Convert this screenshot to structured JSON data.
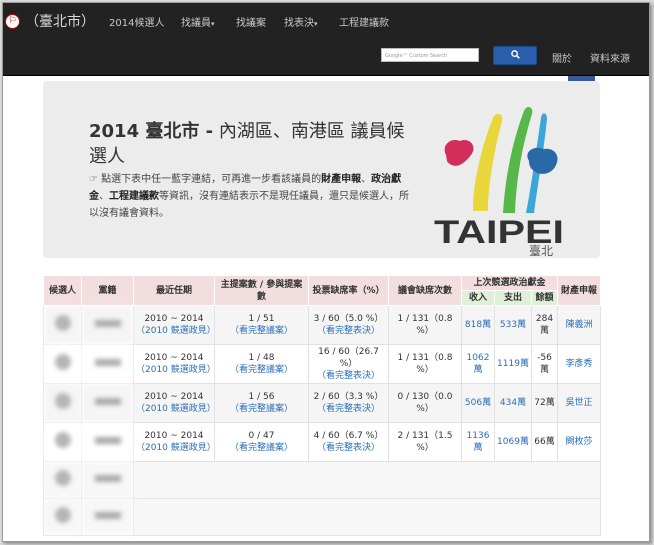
{
  "nav": {
    "brand": "（臺北市）",
    "links": [
      {
        "label": "2014候選人",
        "dropdown": false
      },
      {
        "label": "找議員",
        "dropdown": true
      },
      {
        "label": "找議案",
        "dropdown": false
      },
      {
        "label": "找表決",
        "dropdown": true
      },
      {
        "label": "工程建議款",
        "dropdown": false
      }
    ],
    "search_placeholder": "Google™ Custom Search",
    "about": "關於",
    "sources": "資料來源"
  },
  "jumbotron": {
    "title_year": "2014 臺北市 -",
    "title_rest": " 內湖區、南港區 議員候選人",
    "desc_1": "☞ 點選下表中任一藍字連結，可再進一步看該議員的",
    "desc_b1": "財產申報",
    "desc_2": "、",
    "desc_b2": "政治獻金",
    "desc_3": "、",
    "desc_b3": "工程建議款",
    "desc_4": "等資訊，沒有連結表示不是現任議員，還只是候選人，所以沒有議會資料。",
    "logo_text": "TAIPEI",
    "logo_sub": "臺北"
  },
  "table": {
    "headers": {
      "candidate": "候選人",
      "party": "黨籍",
      "term": "最近任期",
      "bills": "主提案數 / 參與提案數",
      "vote_absent": "投票缺席率（%）",
      "council_absent": "議會缺席次數",
      "donation": "上次競選政治獻金",
      "income": "收入",
      "expense": "支出",
      "balance": "餘額",
      "property": "財產申報"
    },
    "rows": [
      {
        "term": "2010 ~ 2014",
        "term_link": "（2010 競選政見）",
        "bills": "1 / 51",
        "bills_link": "（看完整議案）",
        "vote": "3 / 60（5.0 %）",
        "vote_link": "（看完整表決）",
        "council": "1 / 131（0.8 %）",
        "income": "818萬",
        "expense": "533萬",
        "balance": "284萬",
        "property": "陳義洲"
      },
      {
        "term": "2010 ~ 2014",
        "term_link": "（2010 競選政見）",
        "bills": "1 / 48",
        "bills_link": "（看完整議案）",
        "vote": "16 / 60（26.7 %）",
        "vote_link": "（看完整表決）",
        "council": "1 / 131（0.8 %）",
        "income": "1062萬",
        "expense": "1119萬",
        "balance": "-56萬",
        "property": "李彥秀"
      },
      {
        "term": "2010 ~ 2014",
        "term_link": "（2010 競選政見）",
        "bills": "1 / 56",
        "bills_link": "（看完整議案）",
        "vote": "2 / 60（3.3 %）",
        "vote_link": "（看完整表決）",
        "council": "0 / 130（0.0 %）",
        "income": "506萬",
        "expense": "434萬",
        "balance": "72萬",
        "property": "吳世正"
      },
      {
        "term": "2010 ~ 2014",
        "term_link": "（2010 競選政見）",
        "bills": "0 / 47",
        "bills_link": "（看完整議案）",
        "vote": "4 / 60（6.7 %）",
        "vote_link": "（看完整表決）",
        "council": "2 / 131（1.5 %）",
        "income": "1136萬",
        "expense": "1069萬",
        "balance": "66萬",
        "property": "闕枚莎"
      }
    ]
  }
}
